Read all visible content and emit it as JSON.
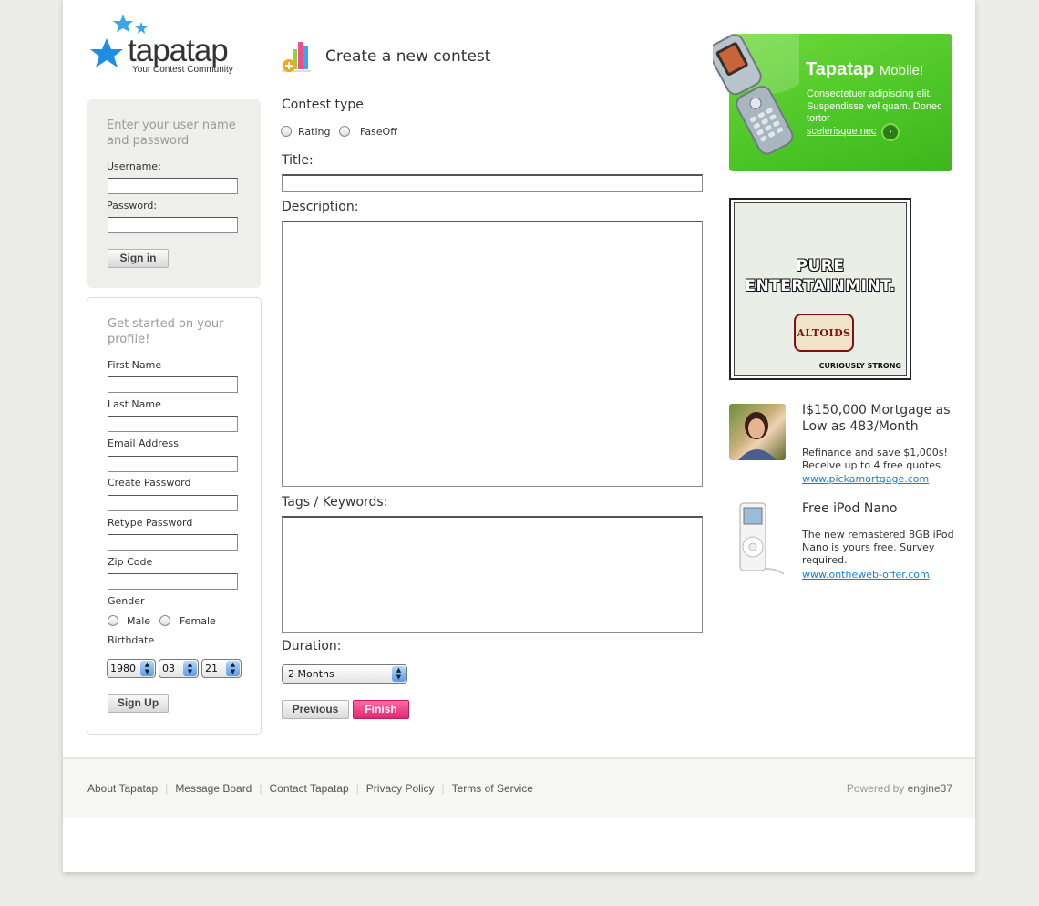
{
  "brand": {
    "name": "tapatap",
    "tagline": "Your Contest Community"
  },
  "login": {
    "heading": "Enter your user name and password",
    "username_label": "Username:",
    "password_label": "Password:",
    "signin_label": "Sign in"
  },
  "signup": {
    "heading": "Get started on your profile!",
    "first_name_label": "First Name",
    "last_name_label": "Last Name",
    "email_label": "Email Address",
    "create_password_label": "Create Password",
    "retype_password_label": "Retype Password",
    "zip_label": "Zip Code",
    "gender_label": "Gender",
    "gender_male": "Male",
    "gender_female": "Female",
    "birthdate_label": "Birthdate",
    "birth_year": "1980",
    "birth_month": "03",
    "birth_day": "21",
    "signup_label": "Sign Up"
  },
  "contest": {
    "heading": "Create a new contest",
    "type_label": "Contest type",
    "type_rating": "Rating",
    "type_faceoff": "FaseOff",
    "title_label": "Title:",
    "description_label": "Description:",
    "tags_label": "Tags / Keywords:",
    "duration_label": "Duration:",
    "duration_value": "2 Months",
    "previous_label": "Previous",
    "finish_label": "Finish"
  },
  "promo": {
    "title": "Tapatap",
    "title_sub": "Mobile!",
    "text": "Consectetuer adipiscing elit. Suspendisse vel quam. Donec tortor",
    "link": "scelerisque nec"
  },
  "altoids": {
    "line1": "PURE",
    "line2": "ENTERTAINMINT.",
    "brand": "ALTOIDS",
    "tagline": "CURIOUSLY STRONG"
  },
  "ads": [
    {
      "title": "I$150,000 Mortgage as Low as 483/Month",
      "body": "Refinance and save $1,000s! Receive up to 4 free quotes.",
      "link": "www.pickamortgage.com"
    },
    {
      "title": "Free iPod Nano",
      "body": "The new remastered 8GB iPod Nano is yours free. Survey required.",
      "link": "www.ontheweb-offer.com"
    }
  ],
  "footer": {
    "links": [
      "About Tapatap",
      "Message Board",
      "Contact Tapatap",
      "Privacy Policy",
      "Terms of Service"
    ],
    "powered_prefix": "Powered by",
    "powered_name": "engine37"
  },
  "colors": {
    "accent_pink": "#e0286e",
    "promo_green": "#4bc526",
    "link_blue": "#1a7fd0",
    "star_blue": "#1e8ee0"
  }
}
